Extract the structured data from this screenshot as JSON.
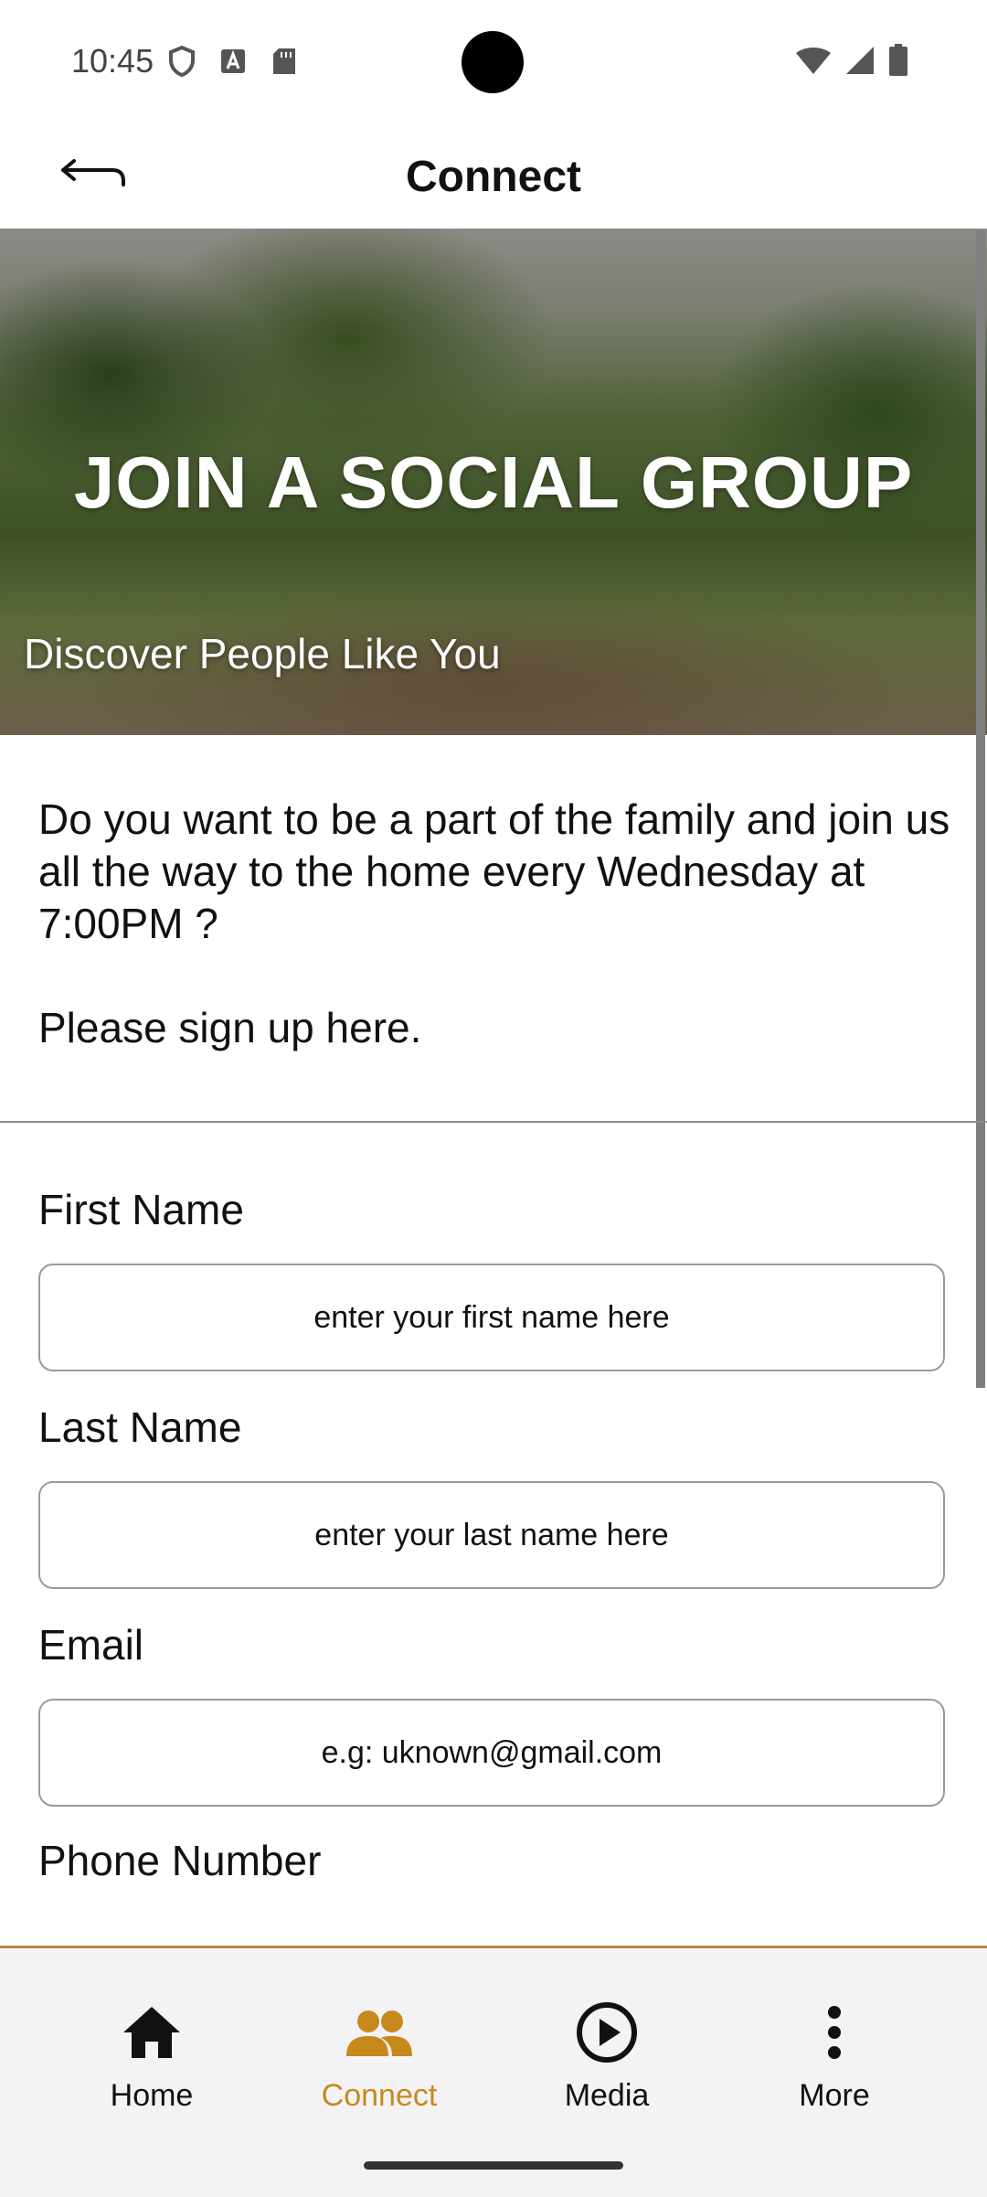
{
  "status_bar": {
    "time": "10:45"
  },
  "app_bar": {
    "title": "Connect"
  },
  "hero": {
    "title": "JOIN A SOCIAL GROUP",
    "subtitle": "Discover People Like You"
  },
  "intro": {
    "question": "Do you want to be a part of the family and join us all the way to the home every Wednesday at 7:00PM ?",
    "signup": "Please sign up here."
  },
  "form": {
    "first_name": {
      "label": "First Name",
      "placeholder": "enter your first name here"
    },
    "last_name": {
      "label": "Last Name",
      "placeholder": "enter your last name here"
    },
    "email": {
      "label": "Email",
      "placeholder": "e.g: uknown@gmail.com"
    },
    "phone": {
      "label": "Phone Number"
    }
  },
  "bottom_nav": {
    "items": [
      {
        "label": "Home",
        "icon": "home-icon"
      },
      {
        "label": "Connect",
        "icon": "people-icon"
      },
      {
        "label": "Media",
        "icon": "play-circle-icon"
      },
      {
        "label": "More",
        "icon": "more-vertical-icon"
      }
    ],
    "active": "Connect"
  },
  "colors": {
    "accent": "#c8891c",
    "nav_background": "#f3f3f5",
    "divider": "#8c8c8c"
  }
}
